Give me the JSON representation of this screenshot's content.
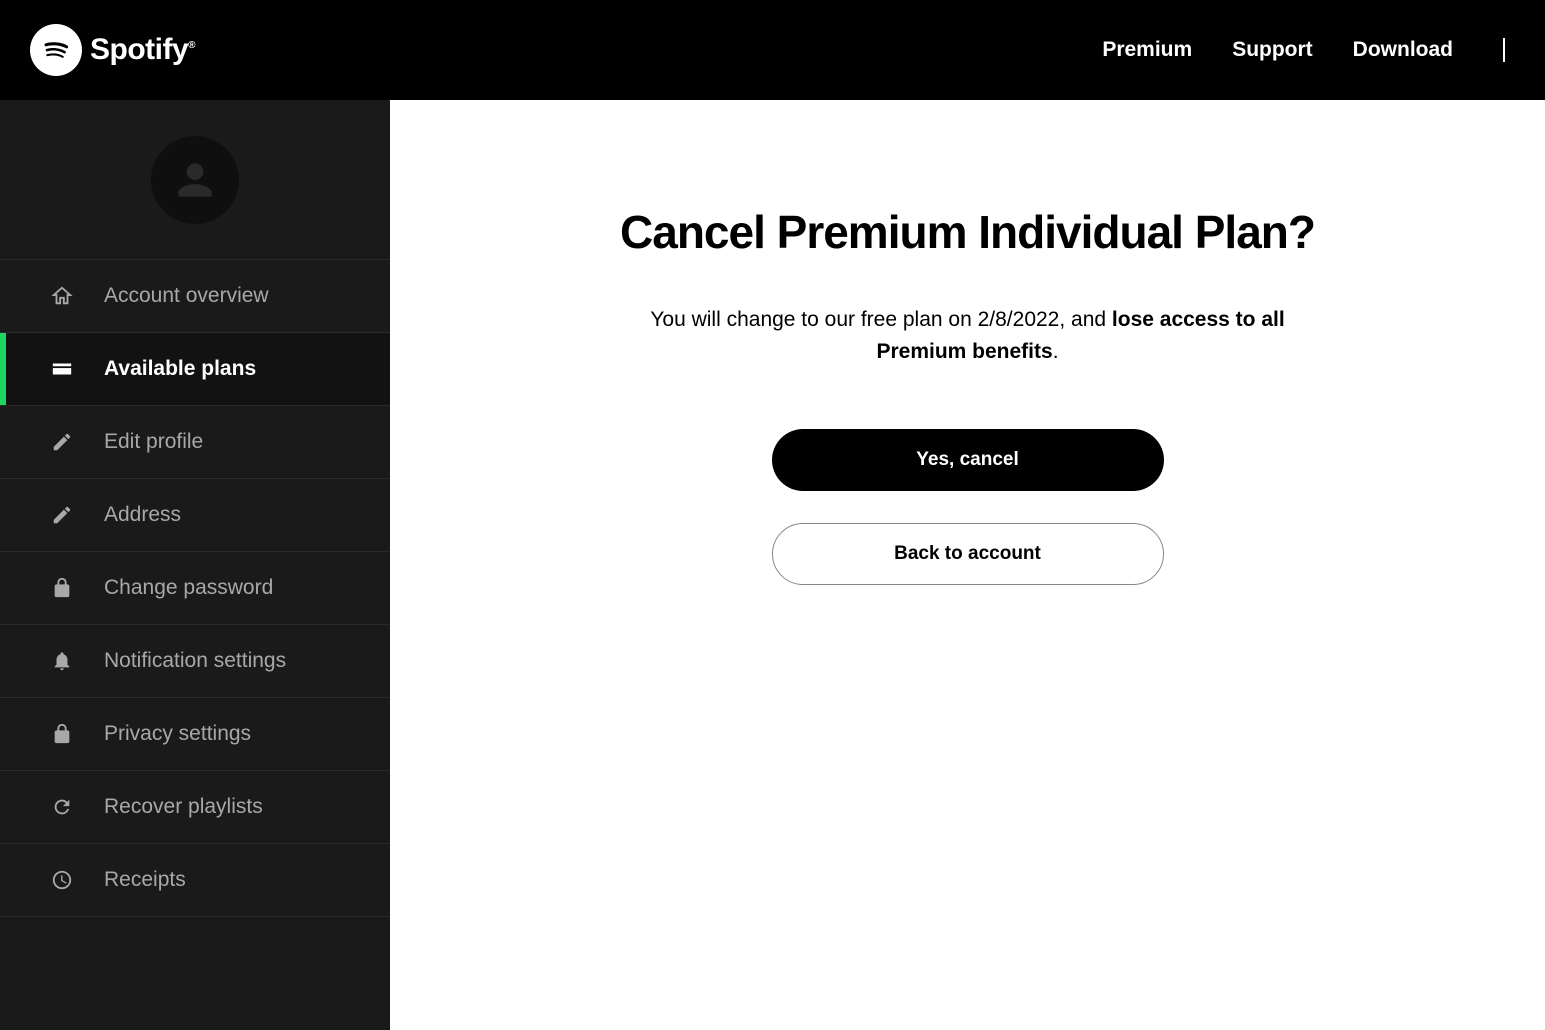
{
  "header": {
    "brand": "Spotify",
    "nav": {
      "premium": "Premium",
      "support": "Support",
      "download": "Download"
    }
  },
  "sidebar": {
    "items": [
      {
        "id": "account-overview",
        "label": "Account overview",
        "icon": "home-icon",
        "active": false
      },
      {
        "id": "available-plans",
        "label": "Available plans",
        "icon": "card-icon",
        "active": true
      },
      {
        "id": "edit-profile",
        "label": "Edit profile",
        "icon": "pencil-icon",
        "active": false
      },
      {
        "id": "address",
        "label": "Address",
        "icon": "pencil-icon",
        "active": false
      },
      {
        "id": "change-password",
        "label": "Change password",
        "icon": "lock-icon",
        "active": false
      },
      {
        "id": "notification-settings",
        "label": "Notification settings",
        "icon": "bell-icon",
        "active": false
      },
      {
        "id": "privacy-settings",
        "label": "Privacy settings",
        "icon": "lock-icon",
        "active": false
      },
      {
        "id": "recover-playlists",
        "label": "Recover playlists",
        "icon": "refresh-icon",
        "active": false
      },
      {
        "id": "receipts",
        "label": "Receipts",
        "icon": "clock-icon",
        "active": false
      }
    ]
  },
  "main": {
    "title": "Cancel Premium Individual Plan?",
    "description_prefix": "You will change to our free plan on ",
    "description_date": "2/8/2022",
    "description_mid": ", and ",
    "description_bold": "lose access to all Premium benefits",
    "description_suffix": ".",
    "buttons": {
      "confirm": "Yes, cancel",
      "back": "Back to account"
    }
  }
}
